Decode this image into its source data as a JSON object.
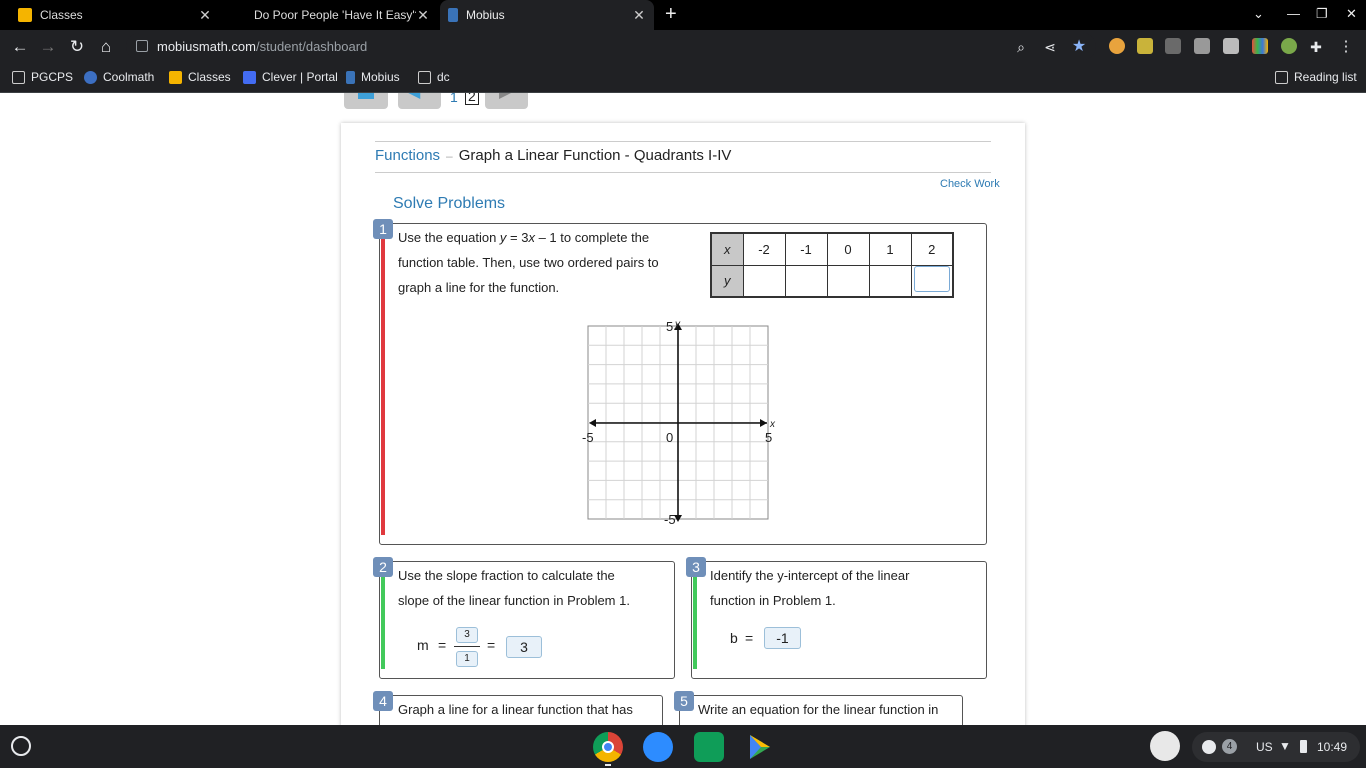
{
  "browser": {
    "tabs": [
      {
        "title": "Classes",
        "active": false
      },
      {
        "title": "Do Poor People 'Have It Easy'? -",
        "active": false
      },
      {
        "title": "Mobius",
        "active": true
      }
    ],
    "new_tab": "+",
    "url_host": "mobiusmath.com",
    "url_path": "/student/dashboard",
    "bookmarks": [
      "PGCPS",
      "Coolmath",
      "Classes",
      "Clever | Portal",
      "Mobius",
      "dc"
    ],
    "reading_list": "Reading list"
  },
  "pager": {
    "page1": "1",
    "page2": "2"
  },
  "lesson": {
    "breadcrumb_link": "Functions",
    "breadcrumb_sep": "–",
    "breadcrumb_current": "Graph a Linear Function - Quadrants I-IV",
    "check_work": "Check Work",
    "section_title": "Solve Problems"
  },
  "problems": {
    "p1": {
      "number": "1",
      "text_a": "Use the equation ",
      "text_eq_y": "y",
      "text_eq_mid": " = 3",
      "text_eq_x": "x",
      "text_eq_end": " – 1 to complete the",
      "text_b": "function table. Then, use two ordered pairs to",
      "text_c": "graph a line for the function.",
      "table": {
        "x_label": "x",
        "y_label": "y",
        "x_values": [
          "-2",
          "-1",
          "0",
          "1",
          "2"
        ],
        "y_values": [
          "",
          "",
          "",
          "",
          ""
        ]
      },
      "graph": {
        "y_max": "5",
        "y_min": "-5",
        "x_min": "-5",
        "x_max": "5",
        "origin": "0",
        "x_axis": "x",
        "y_axis": "y"
      }
    },
    "p2": {
      "number": "2",
      "text_a": "Use the slope fraction to calculate the",
      "text_b": "slope of the linear function in Problem 1.",
      "m_label": "m",
      "eq": "=",
      "numerator": "3",
      "denominator": "1",
      "eq2": "=",
      "answer": "3"
    },
    "p3": {
      "number": "3",
      "text_a": "Identify the y-intercept of the linear",
      "text_b": "function in Problem 1.",
      "b_label": "b",
      "eq": "=",
      "answer": "-1"
    },
    "p4": {
      "number": "4",
      "text_a": "Graph a line for a linear function that has"
    },
    "p5": {
      "number": "5",
      "text_a": "Write an equation for the linear function in"
    }
  },
  "shelf": {
    "locale": "US",
    "time": "10:49",
    "notif_count": "4"
  },
  "colors": {
    "accent": "#2e7bb3",
    "red_bar": "#e0393e",
    "green_bar": "#42c95b",
    "badge": "#6f8fb9"
  }
}
